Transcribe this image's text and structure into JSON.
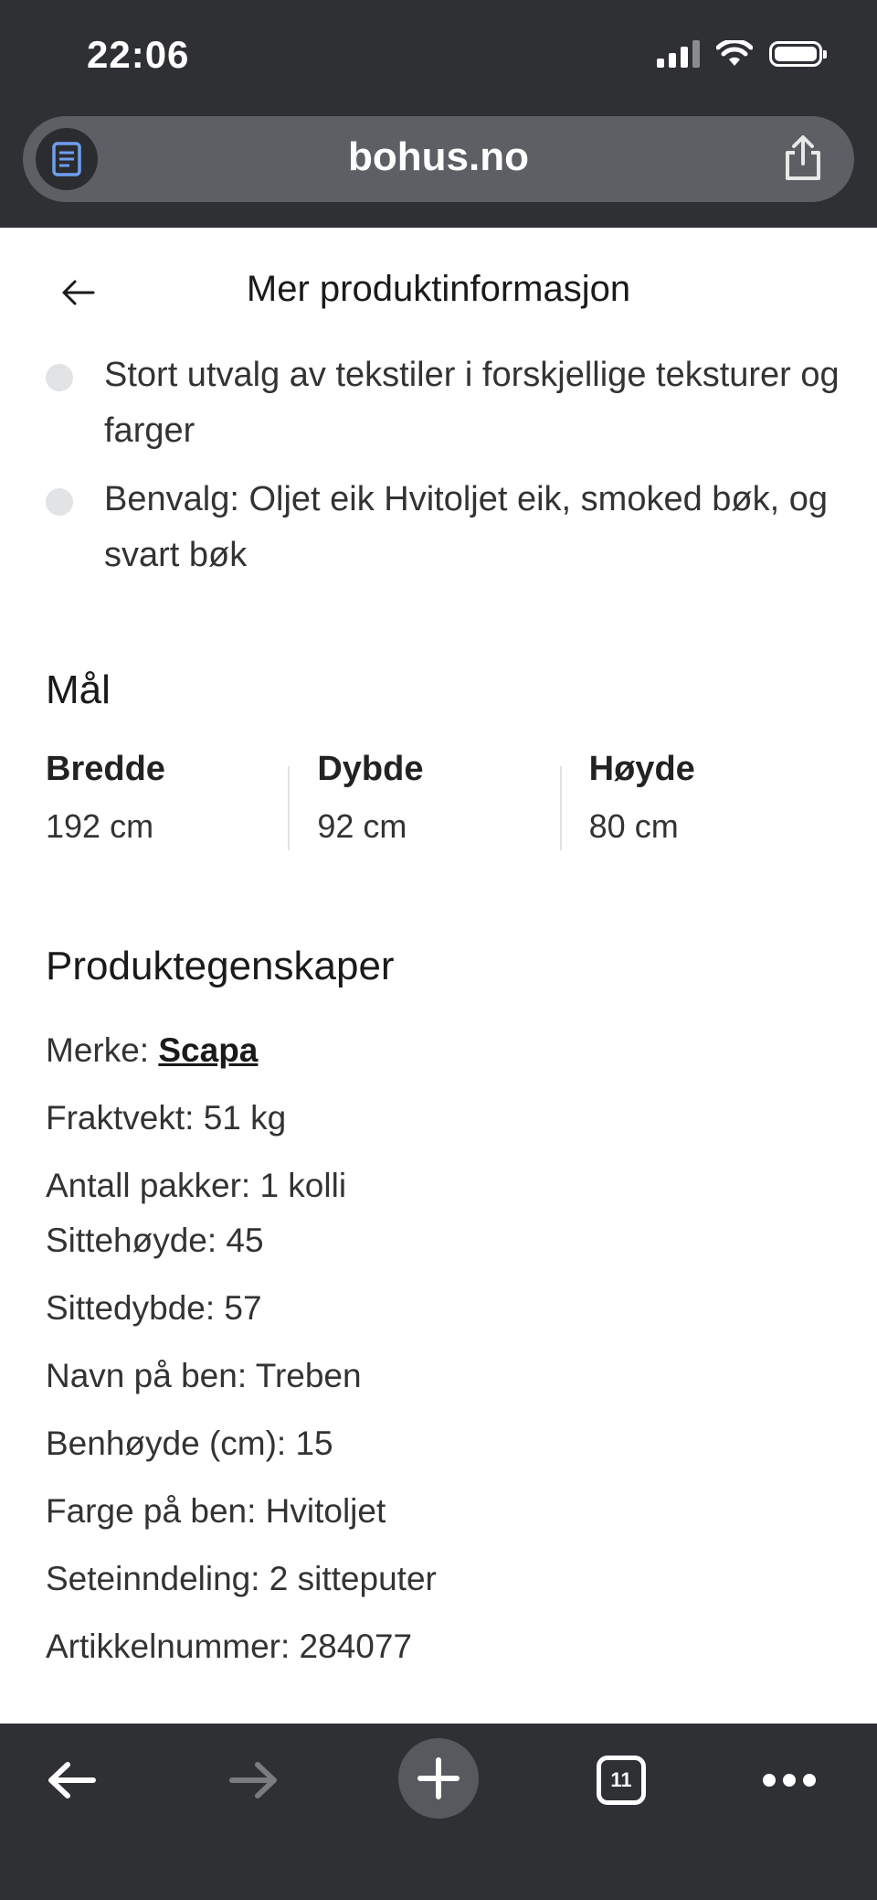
{
  "status_bar": {
    "time": "22:06"
  },
  "browser": {
    "url": "bohus.no",
    "tab_count": "11"
  },
  "header": {
    "title": "Mer produktinformasjon"
  },
  "bullets": [
    "Stort utvalg av tekstiler i forskjellige teksturer og farger",
    "Benvalg: Oljet eik Hvitoljet eik, smoked bøk, og svart bøk"
  ],
  "dimensions": {
    "heading": "Mål",
    "items": [
      {
        "label": "Bredde",
        "value": "192 cm"
      },
      {
        "label": "Dybde",
        "value": "92 cm"
      },
      {
        "label": "Høyde",
        "value": "80 cm"
      }
    ]
  },
  "properties": {
    "heading": "Produktegenskaper",
    "brand_label": "Merke: ",
    "brand_link": "Scapa",
    "lines": [
      "Fraktvekt: 51 kg",
      "Antall pakker: 1 kolli",
      "Sittehøyde: 45",
      "Sittedybde: 57",
      "Navn på ben: Treben",
      "Benhøyde (cm): 15",
      "Farge på ben: Hvitoljet",
      "Seteinndeling: 2 sitteputer",
      "Artikkelnummer: 284077"
    ]
  },
  "icons": {
    "reader": "reader-mode-icon",
    "share": "share-icon",
    "back": "arrow-left-icon",
    "nav_back": "arrow-left-icon",
    "nav_forward": "arrow-right-icon",
    "new_tab": "plus-icon",
    "tabs": "tabs-icon",
    "more": "more-icon"
  },
  "colors": {
    "bar_bg": "#2e3033",
    "url_bg": "#5c5f63",
    "text": "#222222",
    "bullet_dot": "#e1e3e5"
  }
}
